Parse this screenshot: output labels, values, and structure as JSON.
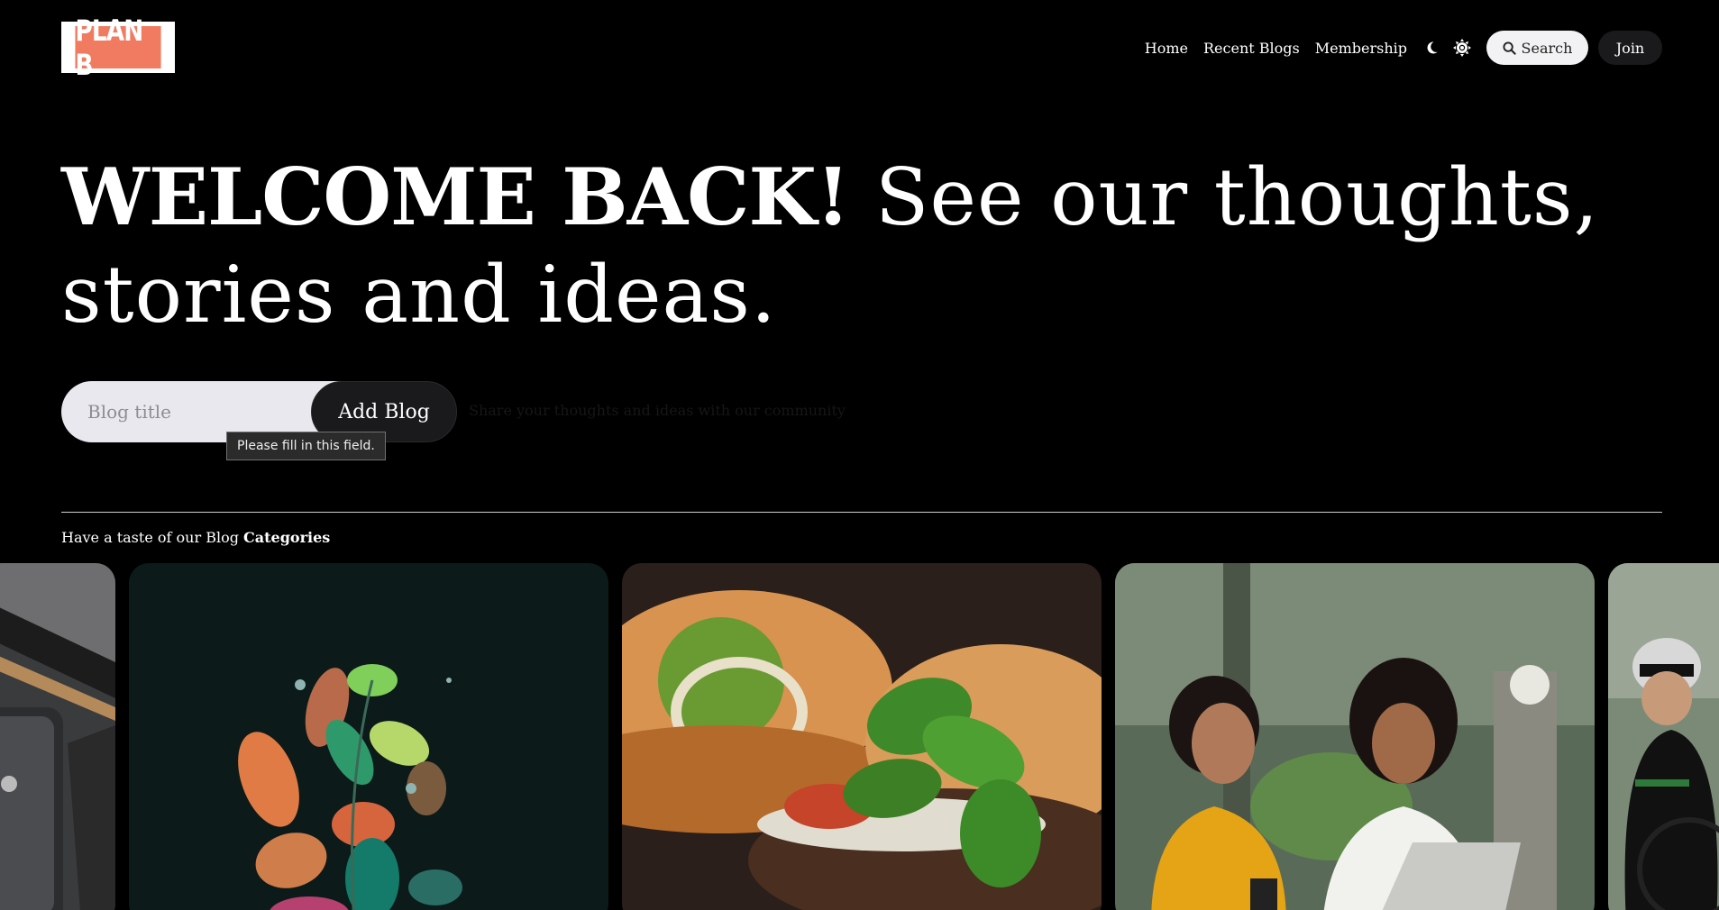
{
  "brand": {
    "logo_text": "PLAN B",
    "accent": "#f07b61"
  },
  "nav": {
    "items": [
      {
        "label": "Home"
      },
      {
        "label": "Recent Blogs"
      },
      {
        "label": "Membership"
      }
    ],
    "theme_icons": [
      "moon-icon",
      "sun-icon"
    ],
    "search_label": "Search",
    "join_label": "Join"
  },
  "hero": {
    "headline_bold": "WELCOME BACK!",
    "headline_rest": "See our thoughts, stories and ideas."
  },
  "blog_form": {
    "title_placeholder": "Blog title",
    "title_value": "",
    "add_label": "Add Blog",
    "share_text": "Share your thoughts and ideas with our community",
    "validation_tooltip": "Please fill in this field."
  },
  "categories": {
    "heading_prefix": "Have a taste of our Blog",
    "heading_strong": "Categories",
    "cards": [
      {
        "image": "laptop-pen-photo"
      },
      {
        "image": "leaf-illustration"
      },
      {
        "image": "burger-basil-photo"
      },
      {
        "image": "women-laughing-laptop-photo"
      },
      {
        "image": "cyclist-photo"
      }
    ]
  }
}
